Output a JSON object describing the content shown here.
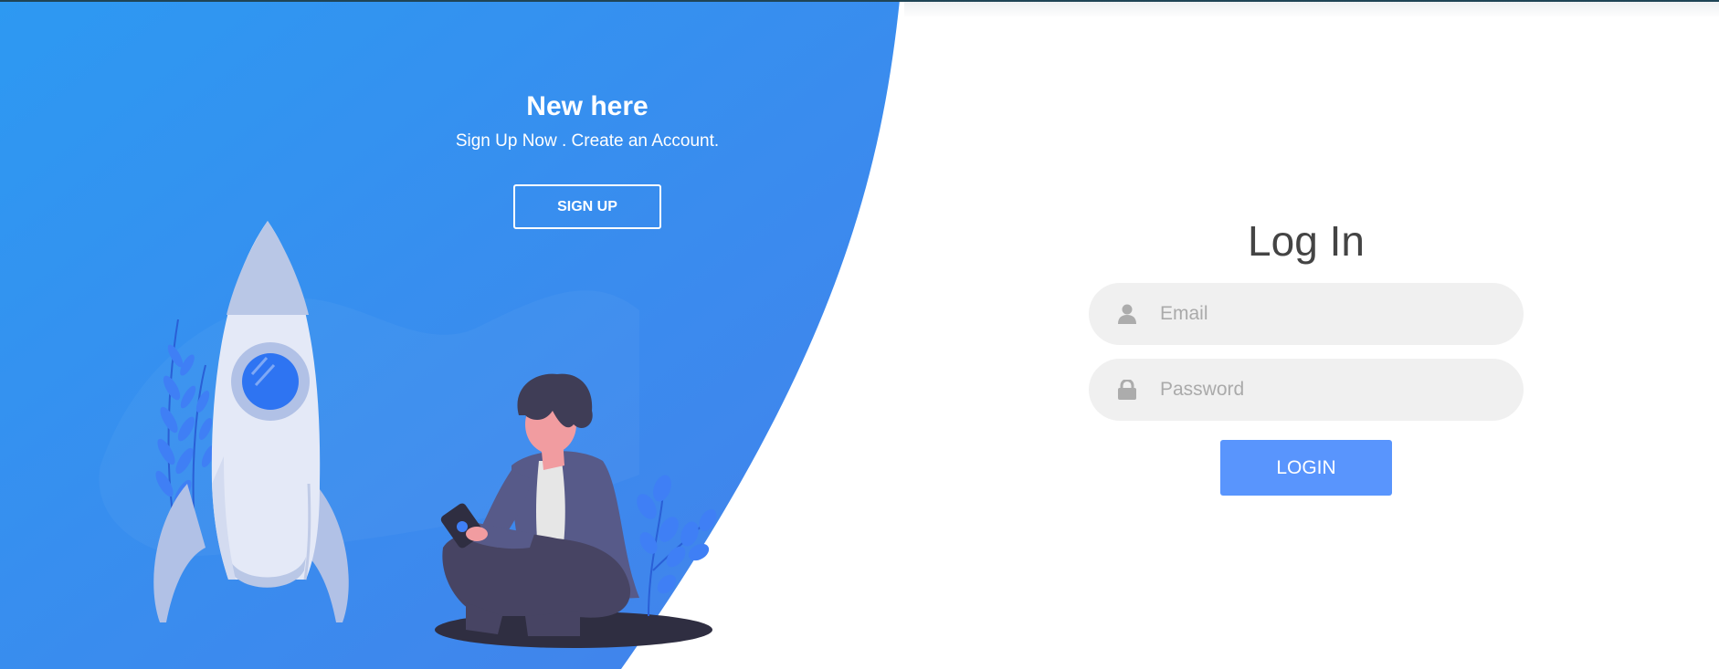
{
  "panel": {
    "title": "New here",
    "subtitle": "Sign Up Now . Create an Account.",
    "signup_label": "SIGN UP"
  },
  "form": {
    "title": "Log In",
    "email_placeholder": "Email",
    "password_placeholder": "Password",
    "login_label": "LOGIN"
  },
  "icons": {
    "email": "user-icon",
    "password": "lock-icon"
  },
  "colors": {
    "panel_gradient_start": "#2d99f2",
    "panel_gradient_end": "#4481eb",
    "accent": "#5995fd",
    "input_background": "#f0f0f0"
  }
}
